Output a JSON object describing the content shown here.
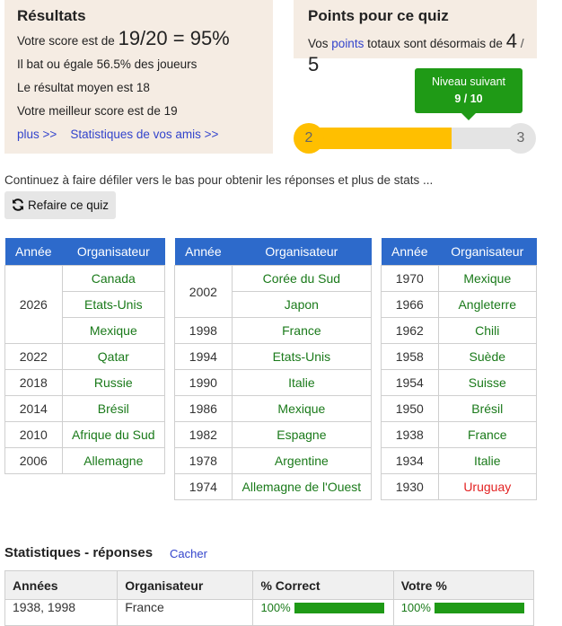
{
  "results": {
    "title": "Résultats",
    "score_prefix": "Votre score est de",
    "score_value": "19/20 = 95%",
    "beat_line": "Il bat ou égale 56.5% des joueurs",
    "average_line": "Le résultat moyen est 18",
    "best_line": "Votre meilleur score est de 19",
    "more_link": "plus >>",
    "friends_link": "Statistiques de vos amis >>"
  },
  "points": {
    "title": "Points pour ce quiz",
    "prefix": "Vos",
    "link": "points",
    "suffix": "totaux sont désormais de",
    "current": "4",
    "sep": "/",
    "total": "5"
  },
  "level": {
    "tooltip_title": "Niveau suivant",
    "tooltip_value": "9 / 10",
    "from_level": "2",
    "to_level": "3",
    "progress_fraction": 0.9
  },
  "hint": "Continuez à faire défiler vers le bas pour obtenir les réponses et plus de stats ...",
  "retry_button": "Refaire ce quiz",
  "hosts_tables": [
    {
      "headers": [
        "Année",
        "Organisateur"
      ],
      "groups": [
        {
          "year": "2026",
          "hosts": [
            "Canada",
            "Etats-Unis",
            "Mexique"
          ]
        },
        {
          "year": "2022",
          "hosts": [
            "Qatar"
          ]
        },
        {
          "year": "2018",
          "hosts": [
            "Russie"
          ]
        },
        {
          "year": "2014",
          "hosts": [
            "Brésil"
          ]
        },
        {
          "year": "2010",
          "hosts": [
            "Afrique du Sud"
          ]
        },
        {
          "year": "2006",
          "hosts": [
            "Allemagne"
          ]
        }
      ]
    },
    {
      "headers": [
        "Année",
        "Organisateur"
      ],
      "groups": [
        {
          "year": "2002",
          "hosts": [
            "Corée du Sud",
            "Japon"
          ]
        },
        {
          "year": "1998",
          "hosts": [
            "France"
          ]
        },
        {
          "year": "1994",
          "hosts": [
            "Etats-Unis"
          ]
        },
        {
          "year": "1990",
          "hosts": [
            "Italie"
          ]
        },
        {
          "year": "1986",
          "hosts": [
            "Mexique"
          ]
        },
        {
          "year": "1982",
          "hosts": [
            "Espagne"
          ]
        },
        {
          "year": "1978",
          "hosts": [
            "Argentine"
          ]
        },
        {
          "year": "1974",
          "hosts": [
            "Allemagne de l'Ouest"
          ]
        }
      ]
    },
    {
      "headers": [
        "Année",
        "Organisateur"
      ],
      "groups": [
        {
          "year": "1970",
          "hosts": [
            "Mexique"
          ]
        },
        {
          "year": "1966",
          "hosts": [
            "Angleterre"
          ]
        },
        {
          "year": "1962",
          "hosts": [
            "Chili"
          ]
        },
        {
          "year": "1958",
          "hosts": [
            "Suède"
          ]
        },
        {
          "year": "1954",
          "hosts": [
            "Suisse"
          ]
        },
        {
          "year": "1950",
          "hosts": [
            "Brésil"
          ]
        },
        {
          "year": "1938",
          "hosts": [
            "France"
          ]
        },
        {
          "year": "1934",
          "hosts": [
            "Italie"
          ]
        },
        {
          "year": "1930",
          "hosts": [
            "Uruguay"
          ],
          "missed": true
        }
      ]
    }
  ],
  "stats": {
    "title": "Statistiques - réponses",
    "hide_link": "Cacher",
    "headers": [
      "Années",
      "Organisateur",
      "% Correct",
      "Votre %"
    ],
    "rows": [
      {
        "years": "1938, 1998",
        "host": "France",
        "correct": "100%",
        "correct_fraction": 1.0,
        "yours": "100%",
        "yours_fraction": 1.0
      }
    ]
  },
  "colors": {
    "card_bg": "#f5ece3",
    "header_blue": "#2d6acb",
    "correct_green": "#1a7a1a",
    "missed_red": "#e32222",
    "progress_yellow": "#ffbf00",
    "tooltip_green": "#1f9a16",
    "link_blue": "#3344cc"
  }
}
